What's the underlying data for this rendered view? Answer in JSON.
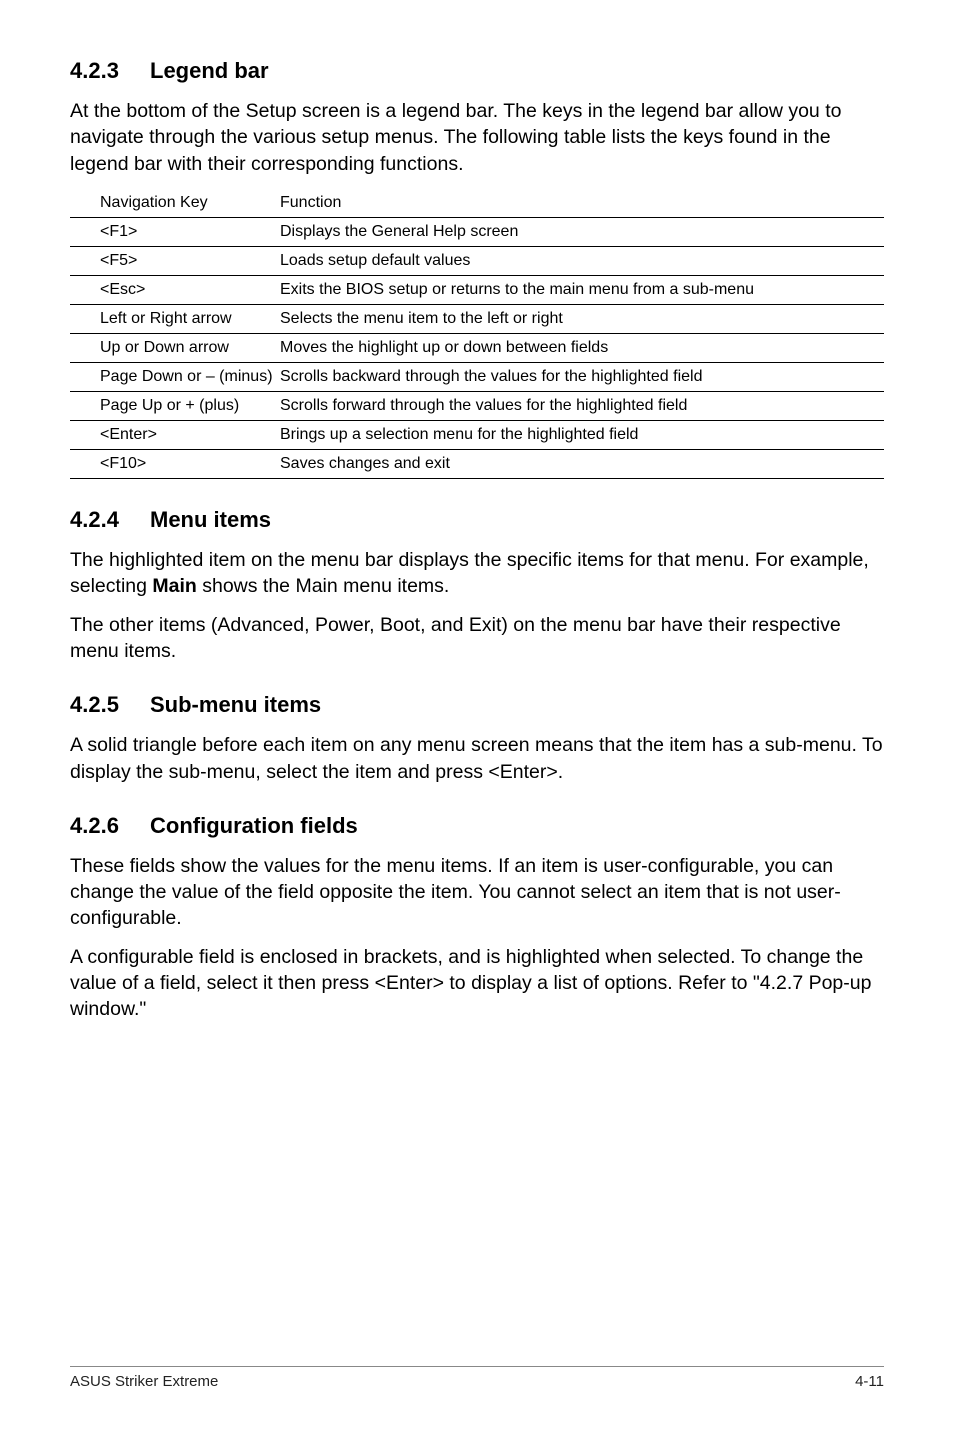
{
  "sections": {
    "s1": {
      "num": "4.2.3",
      "title": "Legend bar"
    },
    "s2": {
      "num": "4.2.4",
      "title": "Menu items"
    },
    "s3": {
      "num": "4.2.5",
      "title": "Sub-menu items"
    },
    "s4": {
      "num": "4.2.6",
      "title": "Configuration fields"
    }
  },
  "paras": {
    "p1": "At the bottom of the Setup screen is a legend bar. The keys in the legend bar allow you to navigate through the various setup menus. The following table lists the keys found in the legend bar with their corresponding functions.",
    "p2a": "The highlighted item on the menu bar  displays the specific items for that menu. For example, selecting ",
    "p2b": "Main",
    "p2c": " shows the Main menu items.",
    "p3": "The other items (Advanced, Power, Boot, and Exit) on the menu bar have their respective menu items.",
    "p4": "A solid triangle before each item on any menu screen means that the item has a sub-menu. To display the sub-menu, select the item and press <Enter>.",
    "p5": "These fields show the values for the menu items. If an item is user-configurable, you can change the value of the field opposite the item. You cannot select an item that is not user-configurable.",
    "p6": "A configurable field is enclosed in brackets, and is highlighted when selected. To change the value of a field, select it then press <Enter> to display a list of options. Refer to \"4.2.7 Pop-up window.\""
  },
  "table": {
    "head": {
      "key": "Navigation Key",
      "func": "Function"
    },
    "rows": [
      {
        "key": "<F1>",
        "func": "Displays the General Help screen"
      },
      {
        "key": "<F5>",
        "func": "Loads setup default values"
      },
      {
        "key": "<Esc>",
        "func": "Exits the BIOS setup or returns to the main menu from a sub-menu"
      },
      {
        "key": "Left or Right arrow",
        "func": "Selects the menu item to the left or right"
      },
      {
        "key": "Up or Down arrow",
        "func": "Moves the highlight up or down between fields"
      },
      {
        "key": "Page Down or – (minus)",
        "func": "Scrolls backward through the values for the highlighted field"
      },
      {
        "key": "Page Up or + (plus)",
        "func": "Scrolls forward through the values for the highlighted field"
      },
      {
        "key": "<Enter>",
        "func": "Brings up a selection menu for the highlighted field"
      },
      {
        "key": "<F10>",
        "func": "Saves changes and exit"
      }
    ]
  },
  "footer": {
    "left": "ASUS Striker Extreme",
    "right": "4-11"
  }
}
